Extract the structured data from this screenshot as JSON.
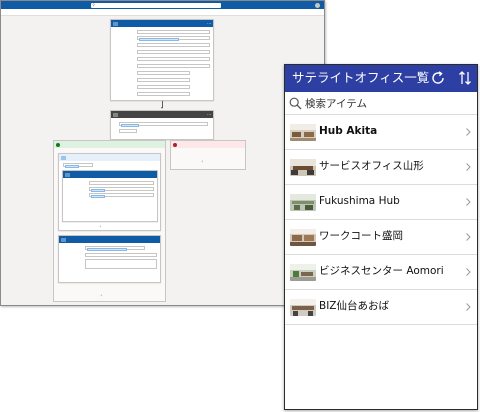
{
  "flow": {
    "title": "",
    "search_placeholder": "",
    "environment": "",
    "command_title": "",
    "command_right": ""
  },
  "app": {
    "title": "サテライトオフィス一覧",
    "search_placeholder": "検索アイテム",
    "items": [
      {
        "label": "Hub Akita",
        "bold": true
      },
      {
        "label": "サービスオフィス山形",
        "bold": false
      },
      {
        "label": "Fukushima Hub",
        "bold": false
      },
      {
        "label": "ワークコート盛岡",
        "bold": false
      },
      {
        "label": "ビジネスセンター Aomori",
        "bold": false
      },
      {
        "label": "BIZ仙台あおば",
        "bold": false
      }
    ],
    "colors": {
      "header": "#2d3fa2",
      "flow_blue": "#0f5ba5"
    },
    "icons": {
      "refresh": "refresh-icon",
      "sort": "sort-icon",
      "search": "search-icon",
      "chevron": "chevron-right-icon"
    }
  }
}
